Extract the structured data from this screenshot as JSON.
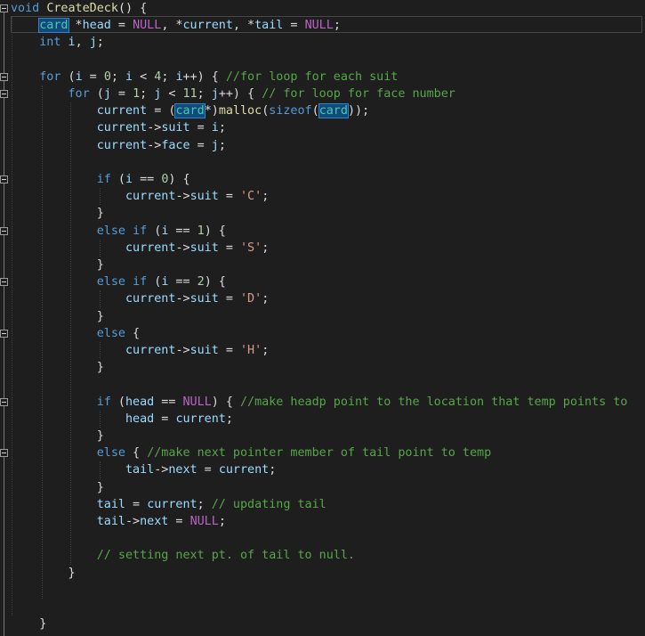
{
  "colors": {
    "background": "#1e1e1e",
    "keyword": "#569cd6",
    "function": "#dcdcaa",
    "variable": "#9cdcfe",
    "number": "#b5cea8",
    "string": "#d69d85",
    "comment": "#57a64a",
    "macro": "#bd63c5",
    "type": "#4ec9b0",
    "plain": "#dcdcdc",
    "highlight": "#0e4a7a"
  },
  "icons": {
    "fold": "collapse-minus-icon"
  },
  "code_lines": [
    [
      [
        "kw",
        "void"
      ],
      [
        "pl",
        " "
      ],
      [
        "fn",
        "CreateDeck"
      ],
      [
        "pl",
        "() {"
      ]
    ],
    [
      [
        "pl",
        "    "
      ],
      [
        "type-hl",
        "card"
      ],
      [
        "pl",
        " *"
      ],
      [
        "var",
        "head"
      ],
      [
        "pl",
        " = "
      ],
      [
        "macro",
        "NULL"
      ],
      [
        "pl",
        ", *"
      ],
      [
        "var",
        "current"
      ],
      [
        "pl",
        ", *"
      ],
      [
        "var",
        "tail"
      ],
      [
        "pl",
        " = "
      ],
      [
        "macro",
        "NULL"
      ],
      [
        "pl",
        ";"
      ]
    ],
    [
      [
        "pl",
        "    "
      ],
      [
        "kw",
        "int"
      ],
      [
        "pl",
        " "
      ],
      [
        "var",
        "i"
      ],
      [
        "pl",
        ", "
      ],
      [
        "var",
        "j"
      ],
      [
        "pl",
        ";"
      ]
    ],
    [],
    [
      [
        "pl",
        "    "
      ],
      [
        "kw",
        "for"
      ],
      [
        "pl",
        " ("
      ],
      [
        "var",
        "i"
      ],
      [
        "pl",
        " = "
      ],
      [
        "num",
        "0"
      ],
      [
        "pl",
        "; "
      ],
      [
        "var",
        "i"
      ],
      [
        "pl",
        " < "
      ],
      [
        "num",
        "4"
      ],
      [
        "pl",
        "; "
      ],
      [
        "var",
        "i"
      ],
      [
        "pl",
        "++) { "
      ],
      [
        "cmt",
        "//for loop for each suit"
      ]
    ],
    [
      [
        "pl",
        "        "
      ],
      [
        "kw",
        "for"
      ],
      [
        "pl",
        " ("
      ],
      [
        "var",
        "j"
      ],
      [
        "pl",
        " = "
      ],
      [
        "num",
        "1"
      ],
      [
        "pl",
        "; "
      ],
      [
        "var",
        "j"
      ],
      [
        "pl",
        " < "
      ],
      [
        "num",
        "11"
      ],
      [
        "pl",
        "; "
      ],
      [
        "var",
        "j"
      ],
      [
        "pl",
        "++) { "
      ],
      [
        "cmt",
        "// for loop for face number"
      ]
    ],
    [
      [
        "pl",
        "            "
      ],
      [
        "var",
        "current"
      ],
      [
        "pl",
        " = ("
      ],
      [
        "type-hl",
        "card"
      ],
      [
        "pl",
        "*)"
      ],
      [
        "fn",
        "malloc"
      ],
      [
        "pl",
        "("
      ],
      [
        "kw",
        "sizeof"
      ],
      [
        "pl",
        "("
      ],
      [
        "type-hl",
        "card"
      ],
      [
        "pl",
        "));"
      ]
    ],
    [
      [
        "pl",
        "            "
      ],
      [
        "var",
        "current"
      ],
      [
        "pl",
        "->"
      ],
      [
        "var",
        "suit"
      ],
      [
        "pl",
        " = "
      ],
      [
        "var",
        "i"
      ],
      [
        "pl",
        ";"
      ]
    ],
    [
      [
        "pl",
        "            "
      ],
      [
        "var",
        "current"
      ],
      [
        "pl",
        "->"
      ],
      [
        "var",
        "face"
      ],
      [
        "pl",
        " = "
      ],
      [
        "var",
        "j"
      ],
      [
        "pl",
        ";"
      ]
    ],
    [],
    [
      [
        "pl",
        "            "
      ],
      [
        "kw",
        "if"
      ],
      [
        "pl",
        " ("
      ],
      [
        "var",
        "i"
      ],
      [
        "pl",
        " == "
      ],
      [
        "num",
        "0"
      ],
      [
        "pl",
        ") {"
      ]
    ],
    [
      [
        "pl",
        "                "
      ],
      [
        "var",
        "current"
      ],
      [
        "pl",
        "->"
      ],
      [
        "var",
        "suit"
      ],
      [
        "pl",
        " = "
      ],
      [
        "str",
        "'C'"
      ],
      [
        "pl",
        ";"
      ]
    ],
    [
      [
        "pl",
        "            }"
      ]
    ],
    [
      [
        "pl",
        "            "
      ],
      [
        "kw",
        "else"
      ],
      [
        "pl",
        " "
      ],
      [
        "kw",
        "if"
      ],
      [
        "pl",
        " ("
      ],
      [
        "var",
        "i"
      ],
      [
        "pl",
        " == "
      ],
      [
        "num",
        "1"
      ],
      [
        "pl",
        ") {"
      ]
    ],
    [
      [
        "pl",
        "                "
      ],
      [
        "var",
        "current"
      ],
      [
        "pl",
        "->"
      ],
      [
        "var",
        "suit"
      ],
      [
        "pl",
        " = "
      ],
      [
        "str",
        "'S'"
      ],
      [
        "pl",
        ";"
      ]
    ],
    [
      [
        "pl",
        "            }"
      ]
    ],
    [
      [
        "pl",
        "            "
      ],
      [
        "kw",
        "else"
      ],
      [
        "pl",
        " "
      ],
      [
        "kw",
        "if"
      ],
      [
        "pl",
        " ("
      ],
      [
        "var",
        "i"
      ],
      [
        "pl",
        " == "
      ],
      [
        "num",
        "2"
      ],
      [
        "pl",
        ") {"
      ]
    ],
    [
      [
        "pl",
        "                "
      ],
      [
        "var",
        "current"
      ],
      [
        "pl",
        "->"
      ],
      [
        "var",
        "suit"
      ],
      [
        "pl",
        " = "
      ],
      [
        "str",
        "'D'"
      ],
      [
        "pl",
        ";"
      ]
    ],
    [
      [
        "pl",
        "            }"
      ]
    ],
    [
      [
        "pl",
        "            "
      ],
      [
        "kw",
        "else"
      ],
      [
        "pl",
        " {"
      ]
    ],
    [
      [
        "pl",
        "                "
      ],
      [
        "var",
        "current"
      ],
      [
        "pl",
        "->"
      ],
      [
        "var",
        "suit"
      ],
      [
        "pl",
        " = "
      ],
      [
        "str",
        "'H'"
      ],
      [
        "pl",
        ";"
      ]
    ],
    [
      [
        "pl",
        "            }"
      ]
    ],
    [],
    [
      [
        "pl",
        "            "
      ],
      [
        "kw",
        "if"
      ],
      [
        "pl",
        " ("
      ],
      [
        "var",
        "head"
      ],
      [
        "pl",
        " == "
      ],
      [
        "macro",
        "NULL"
      ],
      [
        "pl",
        ") { "
      ],
      [
        "cmt",
        "//make headp point to the location that temp points to"
      ]
    ],
    [
      [
        "pl",
        "                "
      ],
      [
        "var",
        "head"
      ],
      [
        "pl",
        " = "
      ],
      [
        "var",
        "current"
      ],
      [
        "pl",
        ";"
      ]
    ],
    [
      [
        "pl",
        "            }"
      ]
    ],
    [
      [
        "pl",
        "            "
      ],
      [
        "kw",
        "else"
      ],
      [
        "pl",
        " { "
      ],
      [
        "cmt",
        "//make next pointer member of tail point to temp"
      ]
    ],
    [
      [
        "pl",
        "                "
      ],
      [
        "var",
        "tail"
      ],
      [
        "pl",
        "->"
      ],
      [
        "var",
        "next"
      ],
      [
        "pl",
        " = "
      ],
      [
        "var",
        "current"
      ],
      [
        "pl",
        ";"
      ]
    ],
    [
      [
        "pl",
        "            }"
      ]
    ],
    [
      [
        "pl",
        "            "
      ],
      [
        "var",
        "tail"
      ],
      [
        "pl",
        " = "
      ],
      [
        "var",
        "current"
      ],
      [
        "pl",
        "; "
      ],
      [
        "cmt",
        "// updating tail"
      ]
    ],
    [
      [
        "pl",
        "            "
      ],
      [
        "var",
        "tail"
      ],
      [
        "pl",
        "->"
      ],
      [
        "var",
        "next"
      ],
      [
        "pl",
        " = "
      ],
      [
        "macro",
        "NULL"
      ],
      [
        "pl",
        ";"
      ]
    ],
    [],
    [
      [
        "pl",
        "            "
      ],
      [
        "cmt",
        "// setting next pt. of tail to null."
      ]
    ],
    [
      [
        "pl",
        "        }"
      ]
    ],
    [],
    [],
    [
      [
        "pl",
        "    }"
      ]
    ]
  ]
}
